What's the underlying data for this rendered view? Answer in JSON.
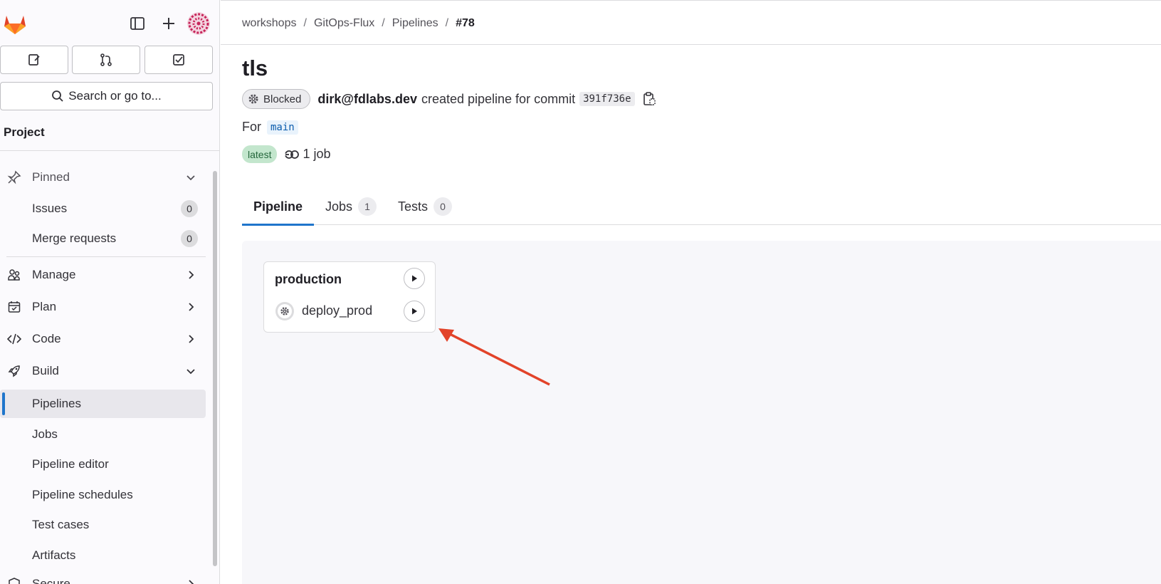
{
  "sidebar": {
    "search_label": "Search or go to...",
    "section_title": "Project",
    "items": [
      {
        "label": "Pinned"
      },
      {
        "label": "Issues",
        "count": "0"
      },
      {
        "label": "Merge requests",
        "count": "0"
      },
      {
        "label": "Manage"
      },
      {
        "label": "Plan"
      },
      {
        "label": "Code"
      },
      {
        "label": "Build"
      },
      {
        "label": "Pipelines"
      },
      {
        "label": "Jobs"
      },
      {
        "label": "Pipeline editor"
      },
      {
        "label": "Pipeline schedules"
      },
      {
        "label": "Test cases"
      },
      {
        "label": "Artifacts"
      },
      {
        "label": "Secure"
      }
    ]
  },
  "breadcrumb": {
    "items": [
      "workshops",
      "GitOps-Flux",
      "Pipelines"
    ],
    "current": "#78"
  },
  "pipeline": {
    "title": "tls",
    "status": "Blocked",
    "author": "dirk@fdlabs.dev",
    "action_text": "created pipeline for commit",
    "sha": "391f736e",
    "for_label": "For",
    "ref": "main",
    "latest_badge": "latest",
    "jobs_count": "1 job"
  },
  "tabs": [
    {
      "label": "Pipeline"
    },
    {
      "label": "Jobs",
      "count": "1"
    },
    {
      "label": "Tests",
      "count": "0"
    }
  ],
  "stage": {
    "name": "production",
    "jobs": [
      {
        "name": "deploy_prod",
        "status": "manual"
      }
    ]
  },
  "colors": {
    "accent": "#1f75cb",
    "annotation_arrow": "#e24329"
  }
}
